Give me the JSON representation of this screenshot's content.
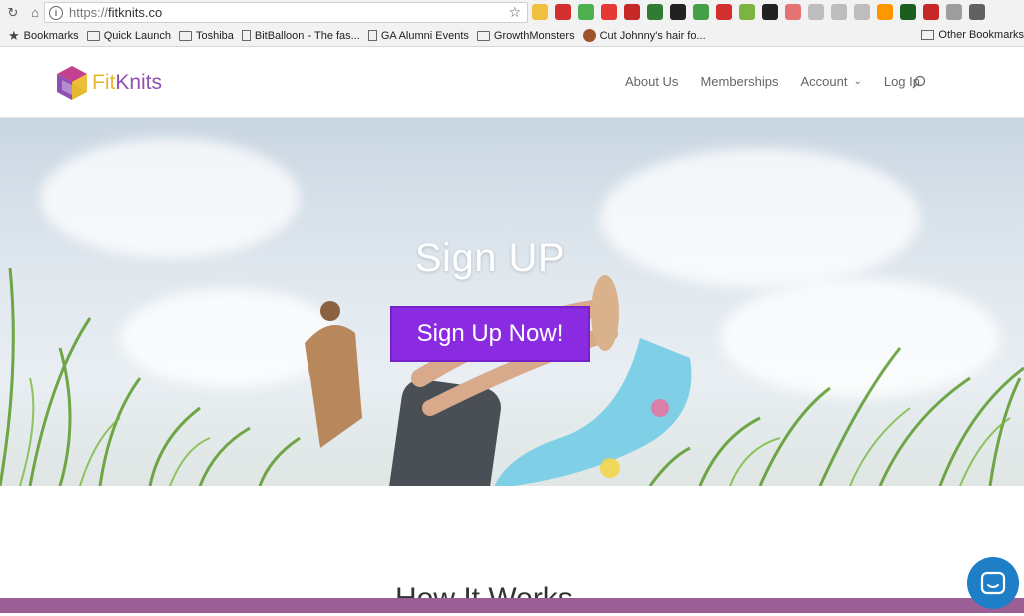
{
  "browser": {
    "url_scheme": "https://",
    "url_host": "fitknits.co",
    "bookmarks": [
      {
        "label": "Bookmarks",
        "icon": "star-icon"
      },
      {
        "label": "Quick Launch",
        "icon": "folder-icon"
      },
      {
        "label": "Toshiba",
        "icon": "folder-icon"
      },
      {
        "label": "BitBalloon - The fas...",
        "icon": "page-icon"
      },
      {
        "label": "GA Alumni Events",
        "icon": "page-icon"
      },
      {
        "label": "GrowthMonsters",
        "icon": "folder-icon"
      },
      {
        "label": "Cut Johnny's hair fo...",
        "icon": "site-icon"
      }
    ],
    "other_bookmarks": "Other Bookmarks",
    "extension_colors": [
      "#f0c040",
      "#d32f2f",
      "#4caf50",
      "#e53935",
      "#c62828",
      "#2e7d32",
      "#212121",
      "#43a047",
      "#d32f2f",
      "#7cb342",
      "#212121",
      "#e57373",
      "#bdbdbd",
      "#bdbdbd",
      "#bdbdbd",
      "#ff9800",
      "#1b5e20",
      "#c62828",
      "#9e9e9e",
      "#616161"
    ]
  },
  "site": {
    "logo_fit": "Fit",
    "logo_knits": "Knits",
    "nav": {
      "about": "About Us",
      "memberships": "Memberships",
      "account": "Account",
      "login": "Log In"
    },
    "hero": {
      "title": "Sign UP",
      "button": "Sign Up Now!"
    },
    "section_title": "How It Works",
    "colors": {
      "accent": "#8a2be2",
      "logo_yellow": "#e6b82e",
      "logo_purple": "#8e4fb5",
      "chat": "#1e7fc7"
    }
  }
}
